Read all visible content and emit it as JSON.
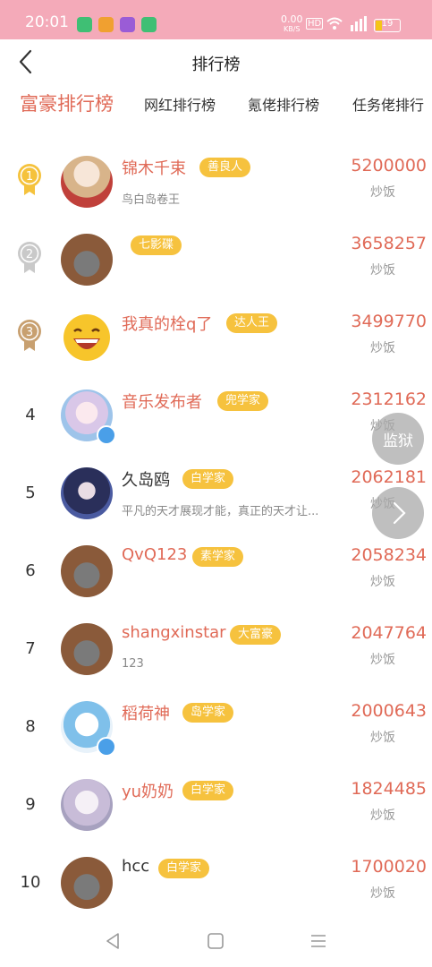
{
  "status": {
    "time": "20:01",
    "speed": "0.00",
    "speed_unit": "KB/S",
    "hd": "HD",
    "battery": "19"
  },
  "header": {
    "title": "排行榜"
  },
  "tabs": [
    {
      "label": "富豪排行榜"
    },
    {
      "label": "网红排行榜"
    },
    {
      "label": "氪佬排行榜"
    },
    {
      "label": "任务佬排行"
    }
  ],
  "rows": [
    {
      "rank": "1",
      "name": "锦木千束",
      "badge": "善良人",
      "sub": "鸟白岛卷王",
      "score": "5200000",
      "unit": "炒饭"
    },
    {
      "rank": "2",
      "name": "",
      "badge": "七影碟",
      "sub": "",
      "score": "3658257",
      "unit": "炒饭"
    },
    {
      "rank": "3",
      "name": "我真的栓q了",
      "badge": "达人王",
      "sub": "",
      "score": "3499770",
      "unit": "炒饭"
    },
    {
      "rank": "4",
      "name": "音乐发布者",
      "badge": "兜学家",
      "sub": "",
      "score": "2312162",
      "unit": "炒饭"
    },
    {
      "rank": "5",
      "name": "久岛鸥",
      "badge": "白学家",
      "sub": "平凡的天才展现才能，真正的天才让...",
      "score": "2062181",
      "unit": "炒饭"
    },
    {
      "rank": "6",
      "name": "QvQ123",
      "badge": "素学家",
      "sub": "",
      "score": "2058234",
      "unit": "炒饭"
    },
    {
      "rank": "7",
      "name": "shangxinstar",
      "badge": "大富豪",
      "sub": "123",
      "score": "2047764",
      "unit": "炒饭"
    },
    {
      "rank": "8",
      "name": "稻荷神",
      "badge": "岛学家",
      "sub": "",
      "score": "2000643",
      "unit": "炒饭"
    },
    {
      "rank": "9",
      "name": "yu奶奶",
      "badge": "白学家",
      "sub": "",
      "score": "1824485",
      "unit": "炒饭"
    },
    {
      "rank": "10",
      "name": "hcc",
      "badge": "白学家",
      "sub": "",
      "score": "1700020",
      "unit": "炒饭"
    }
  ],
  "float": {
    "jail_label": "监狱"
  },
  "colors": {
    "accent": "#e06a57",
    "badge": "#f6c23e",
    "statusbar": "#f4aab9"
  }
}
